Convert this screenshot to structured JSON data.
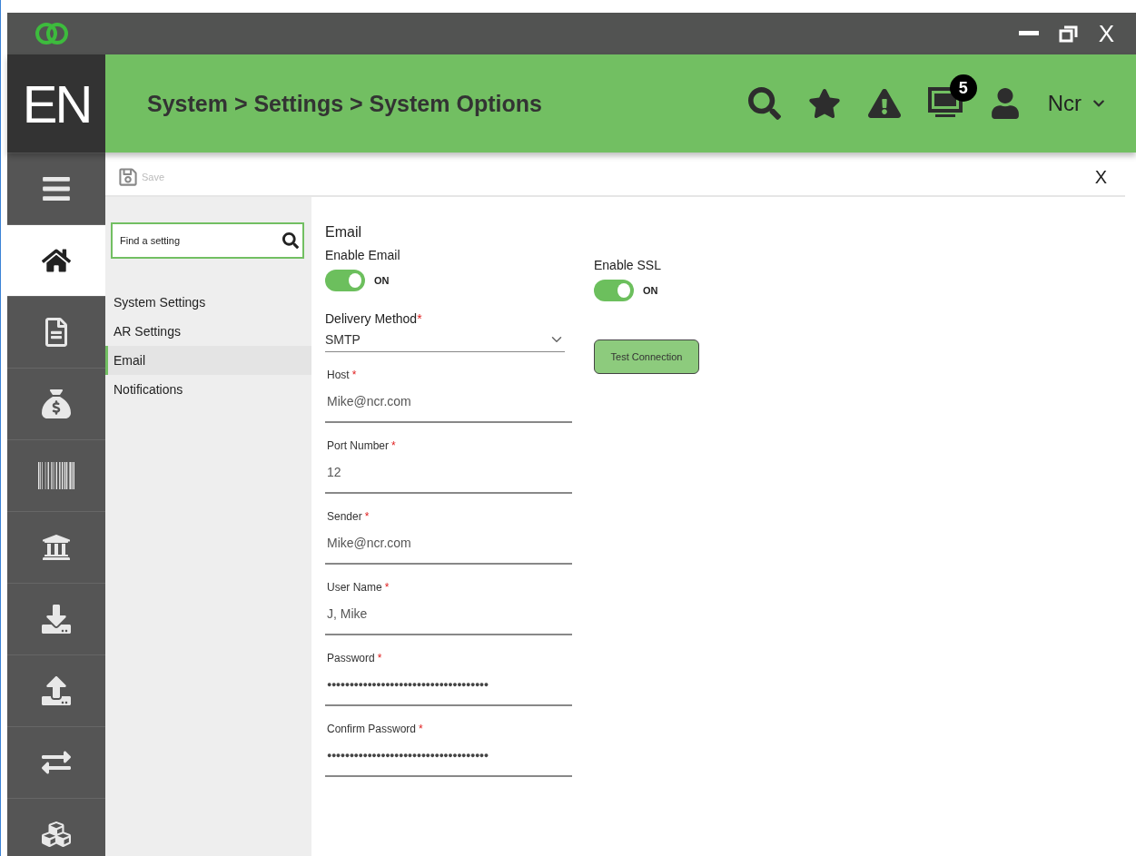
{
  "titlebar": {
    "close": "X"
  },
  "header": {
    "brand": "EN",
    "breadcrumb": "System > Settings > System Options",
    "badge": "5",
    "user": "Ncr"
  },
  "nav": {
    "items": [
      {
        "kind": "menu",
        "selected": false
      },
      {
        "kind": "home",
        "selected": true
      },
      {
        "kind": "documents",
        "selected": false
      },
      {
        "kind": "money",
        "selected": false
      },
      {
        "kind": "barcode",
        "selected": false
      },
      {
        "kind": "bank",
        "selected": false
      },
      {
        "kind": "download",
        "selected": false
      },
      {
        "kind": "upload",
        "selected": false
      },
      {
        "kind": "transfer",
        "selected": false
      },
      {
        "kind": "cubes",
        "selected": false
      }
    ]
  },
  "toolbar": {
    "save": "Save",
    "save_disabled": true,
    "close": "X"
  },
  "settings_nav": {
    "search_placeholder": "Find a setting",
    "items": [
      {
        "label": "System Settings",
        "selected": false
      },
      {
        "label": "AR Settings",
        "selected": false
      },
      {
        "label": "Email",
        "selected": true
      },
      {
        "label": "Notifications",
        "selected": false
      }
    ]
  },
  "form": {
    "title": "Email",
    "required_mark": "*",
    "toggles": [
      {
        "label": "Enable Email",
        "on": true,
        "state_text": "ON"
      },
      {
        "label": "Enable SSL",
        "on": true,
        "state_text": "ON"
      }
    ],
    "delivery": {
      "label": "Delivery Method",
      "required": true,
      "value": "SMTP"
    },
    "test_button": "Test Connection",
    "fields": [
      {
        "label": "Host",
        "required": true,
        "value": "Mike@ncr.com"
      },
      {
        "label": "Port Number",
        "required": true,
        "value": "12"
      },
      {
        "label": "Sender",
        "required": true,
        "value": "Mike@ncr.com"
      },
      {
        "label": "User Name",
        "required": true,
        "value": "J, Mike"
      },
      {
        "label": "Password",
        "required": true,
        "value": "●●●●●●●●●●●●●●●●●●●●●●●●●●●●●●●●●●●●"
      },
      {
        "label": "Confirm Password",
        "required": true,
        "value": "●●●●●●●●●●●●●●●●●●●●●●●●●●●●●●●●●●●●"
      }
    ]
  }
}
